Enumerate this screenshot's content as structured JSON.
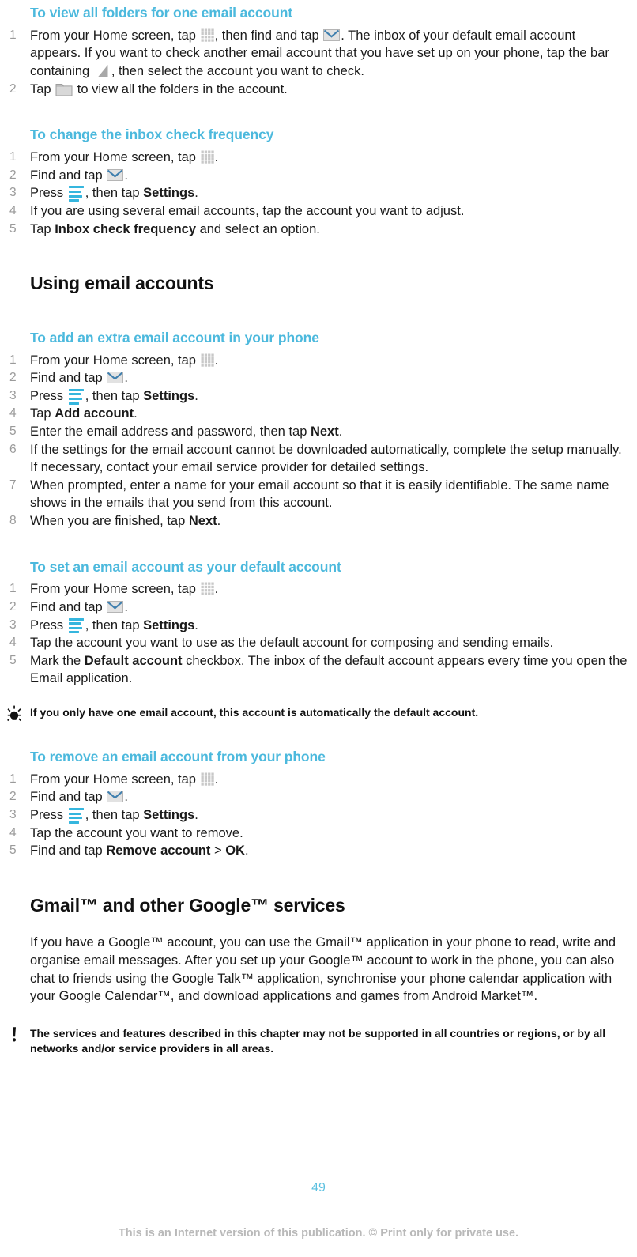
{
  "document": {
    "page_number": "49",
    "footer_note": "This is an Internet version of this publication. © Print only for private use.",
    "accent_color": "#4cb9dd",
    "heading_color": "#4cb9dd",
    "number_color": "#9a9a9a"
  },
  "sections": [
    {
      "id": "view-all-folders",
      "heading": "To view all folders for one email account",
      "steps": [
        {
          "parts": [
            {
              "type": "text",
              "value": "From your Home screen, tap "
            },
            {
              "type": "icon",
              "name": "app-grid-icon"
            },
            {
              "type": "text",
              "value": ", then find and tap "
            },
            {
              "type": "icon",
              "name": "envelope-icon"
            },
            {
              "type": "text",
              "value": ". The inbox of your default email account appears. If you want to check another email account that you have set up on your phone, tap the bar containing "
            },
            {
              "type": "icon",
              "name": "triangle-icon"
            },
            {
              "type": "text",
              "value": ", then select the account you want to check."
            }
          ]
        },
        {
          "parts": [
            {
              "type": "text",
              "value": "Tap "
            },
            {
              "type": "icon",
              "name": "folder-icon"
            },
            {
              "type": "text",
              "value": " to view all the folders in the account."
            }
          ]
        }
      ]
    },
    {
      "id": "inbox-check-frequency",
      "heading": "To change the inbox check frequency",
      "steps": [
        {
          "parts": [
            {
              "type": "text",
              "value": "From your Home screen, tap "
            },
            {
              "type": "icon",
              "name": "app-grid-icon"
            },
            {
              "type": "text",
              "value": "."
            }
          ]
        },
        {
          "parts": [
            {
              "type": "text",
              "value": "Find and tap "
            },
            {
              "type": "icon",
              "name": "envelope-icon"
            },
            {
              "type": "text",
              "value": "."
            }
          ]
        },
        {
          "parts": [
            {
              "type": "text",
              "value": "Press "
            },
            {
              "type": "icon",
              "name": "menu-icon"
            },
            {
              "type": "text",
              "value": ", then tap "
            },
            {
              "type": "bold",
              "value": "Settings"
            },
            {
              "type": "text",
              "value": "."
            }
          ]
        },
        {
          "parts": [
            {
              "type": "text",
              "value": "If you are using several email accounts, tap the account you want to adjust."
            }
          ]
        },
        {
          "parts": [
            {
              "type": "text",
              "value": "Tap "
            },
            {
              "type": "bold",
              "value": "Inbox check frequency"
            },
            {
              "type": "text",
              "value": " and select an option."
            }
          ]
        }
      ]
    }
  ],
  "chapter_heading_1": "Using email accounts",
  "sections_2": [
    {
      "id": "add-extra-account",
      "heading": "To add an extra email account in your phone",
      "steps": [
        {
          "parts": [
            {
              "type": "text",
              "value": "From your Home screen, tap "
            },
            {
              "type": "icon",
              "name": "app-grid-icon"
            },
            {
              "type": "text",
              "value": "."
            }
          ]
        },
        {
          "parts": [
            {
              "type": "text",
              "value": "Find and tap "
            },
            {
              "type": "icon",
              "name": "envelope-icon"
            },
            {
              "type": "text",
              "value": "."
            }
          ]
        },
        {
          "parts": [
            {
              "type": "text",
              "value": "Press "
            },
            {
              "type": "icon",
              "name": "menu-icon"
            },
            {
              "type": "text",
              "value": ", then tap "
            },
            {
              "type": "bold",
              "value": "Settings"
            },
            {
              "type": "text",
              "value": "."
            }
          ]
        },
        {
          "parts": [
            {
              "type": "text",
              "value": "Tap "
            },
            {
              "type": "bold",
              "value": "Add account"
            },
            {
              "type": "text",
              "value": "."
            }
          ]
        },
        {
          "parts": [
            {
              "type": "text",
              "value": "Enter the email address and password, then tap "
            },
            {
              "type": "bold",
              "value": "Next"
            },
            {
              "type": "text",
              "value": "."
            }
          ]
        },
        {
          "parts": [
            {
              "type": "text",
              "value": "If the settings for the email account cannot be downloaded automatically, complete the setup manually. If necessary, contact your email service provider for detailed settings."
            }
          ]
        },
        {
          "parts": [
            {
              "type": "text",
              "value": "When prompted, enter a name for your email account so that it is easily identifiable. The same name shows in the emails that you send from this account."
            }
          ]
        },
        {
          "parts": [
            {
              "type": "text",
              "value": "When you are finished, tap "
            },
            {
              "type": "bold",
              "value": "Next"
            },
            {
              "type": "text",
              "value": "."
            }
          ]
        }
      ]
    },
    {
      "id": "set-default-account",
      "heading": "To set an email account as your default account",
      "steps": [
        {
          "parts": [
            {
              "type": "text",
              "value": "From your Home screen, tap "
            },
            {
              "type": "icon",
              "name": "app-grid-icon"
            },
            {
              "type": "text",
              "value": "."
            }
          ]
        },
        {
          "parts": [
            {
              "type": "text",
              "value": "Find and tap "
            },
            {
              "type": "icon",
              "name": "envelope-icon"
            },
            {
              "type": "text",
              "value": "."
            }
          ]
        },
        {
          "parts": [
            {
              "type": "text",
              "value": "Press "
            },
            {
              "type": "icon",
              "name": "menu-icon"
            },
            {
              "type": "text",
              "value": ", then tap "
            },
            {
              "type": "bold",
              "value": "Settings"
            },
            {
              "type": "text",
              "value": "."
            }
          ]
        },
        {
          "parts": [
            {
              "type": "text",
              "value": "Tap the account you want to use as the default account for composing and sending emails."
            }
          ]
        },
        {
          "parts": [
            {
              "type": "text",
              "value": "Mark the "
            },
            {
              "type": "bold",
              "value": "Default account"
            },
            {
              "type": "text",
              "value": " checkbox. The inbox of the default account appears every time you open the Email application."
            }
          ]
        }
      ]
    }
  ],
  "tip": {
    "icon": "lightbulb-icon",
    "text": "If you only have one email account, this account is automatically the default account."
  },
  "sections_3": [
    {
      "id": "remove-account",
      "heading": "To remove an email account from your phone",
      "steps": [
        {
          "parts": [
            {
              "type": "text",
              "value": "From your Home screen, tap "
            },
            {
              "type": "icon",
              "name": "app-grid-icon"
            },
            {
              "type": "text",
              "value": "."
            }
          ]
        },
        {
          "parts": [
            {
              "type": "text",
              "value": "Find and tap "
            },
            {
              "type": "icon",
              "name": "envelope-icon"
            },
            {
              "type": "text",
              "value": "."
            }
          ]
        },
        {
          "parts": [
            {
              "type": "text",
              "value": "Press "
            },
            {
              "type": "icon",
              "name": "menu-icon"
            },
            {
              "type": "text",
              "value": ", then tap "
            },
            {
              "type": "bold",
              "value": "Settings"
            },
            {
              "type": "text",
              "value": "."
            }
          ]
        },
        {
          "parts": [
            {
              "type": "text",
              "value": "Tap the account you want to remove."
            }
          ]
        },
        {
          "parts": [
            {
              "type": "text",
              "value": "Find and tap "
            },
            {
              "type": "bold",
              "value": "Remove account"
            },
            {
              "type": "text",
              "value": " > "
            },
            {
              "type": "bold",
              "value": "OK"
            },
            {
              "type": "text",
              "value": "."
            }
          ]
        }
      ]
    }
  ],
  "chapter_heading_2": "Gmail™ and other Google™ services",
  "gmail_paragraph": "If you have a Google™ account, you can use the Gmail™ application in your phone to read, write and organise email messages. After you set up your Google™ account to work in the phone, you can also chat to friends using the Google Talk™ application, synchronise your phone calendar application with your Google Calendar™, and download applications and games from Android Market™.",
  "warning": {
    "icon": "exclamation-icon",
    "text": "The services and features described in this chapter may not be supported in all countries or regions, or by all networks and/or service providers in all areas."
  }
}
